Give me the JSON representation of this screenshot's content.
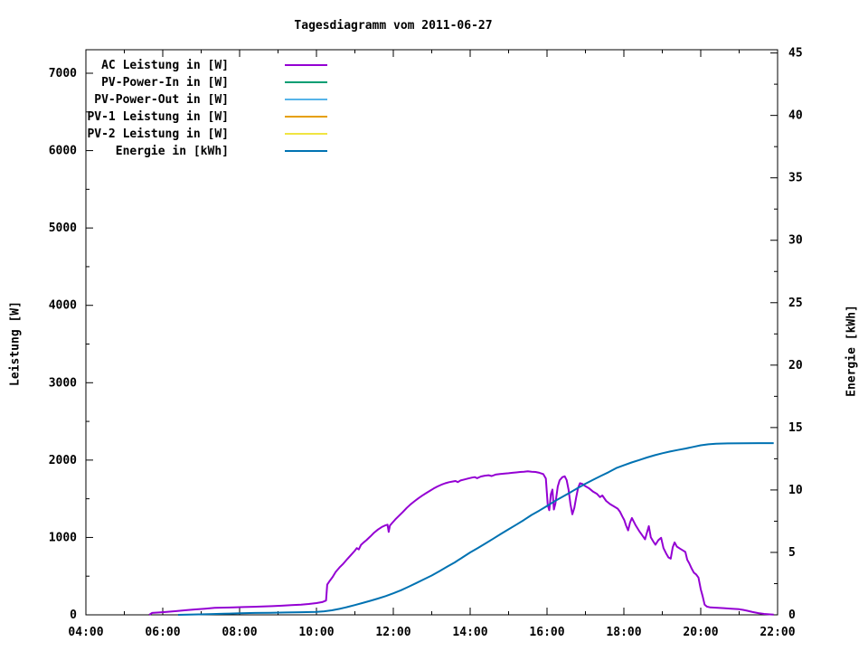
{
  "title": "Tagesdiagramm vom 2011-06-27",
  "axes": {
    "x": {
      "min_hour": 4,
      "max_hour": 22,
      "major_step_hours": 2,
      "minor_step_hours": 1,
      "tick_labels": [
        "04:00",
        "06:00",
        "08:00",
        "10:00",
        "12:00",
        "14:00",
        "16:00",
        "18:00",
        "20:00",
        "22:00"
      ]
    },
    "y_left": {
      "label": "Leistung [W]",
      "min": 0,
      "max": 7000,
      "major_step": 1000,
      "minor_step": 500,
      "tick_labels": [
        "0",
        "1000",
        "2000",
        "3000",
        "4000",
        "5000",
        "6000",
        "7000"
      ]
    },
    "y_right": {
      "label": "Energie [kWh]",
      "min": 0,
      "max": 45,
      "major_step": 5,
      "minor_step": 2.5,
      "tick_labels": [
        "0",
        "5",
        "10",
        "15",
        "20",
        "25",
        "30",
        "35",
        "40",
        "45"
      ]
    }
  },
  "legend": {
    "position": "inside-top-left",
    "items": [
      {
        "label": "AC Leistung in [W]",
        "color": "#9400d3"
      },
      {
        "label": "PV-Power-In in [W]",
        "color": "#009e73"
      },
      {
        "label": "PV-Power-Out in [W]",
        "color": "#56b4e9"
      },
      {
        "label": "PV-1 Leistung in [W]",
        "color": "#e69f00"
      },
      {
        "label": "PV-2 Leistung in [W]",
        "color": "#f0e442"
      },
      {
        "label": "Energie in [kWh]",
        "color": "#0072b2"
      }
    ]
  },
  "chart_data": {
    "type": "line",
    "title": "Tagesdiagramm vom 2011-06-27",
    "xlabel": "",
    "ylabel": "Leistung [W]",
    "y2label": "Energie [kWh]",
    "x_range_hours": [
      4,
      22
    ],
    "y_left_range": [
      0,
      7000
    ],
    "y_right_range": [
      0,
      45
    ],
    "grid": false,
    "legend_position": "inside-top-left",
    "series": [
      {
        "name": "AC Leistung in [W]",
        "color": "#9400d3",
        "axis": "left",
        "unit": "W",
        "points": [
          [
            5.65,
            0
          ],
          [
            5.72,
            25
          ],
          [
            5.9,
            30
          ],
          [
            6.1,
            38
          ],
          [
            6.35,
            48
          ],
          [
            6.6,
            60
          ],
          [
            6.85,
            70
          ],
          [
            7.1,
            80
          ],
          [
            7.35,
            90
          ],
          [
            7.6,
            93
          ],
          [
            7.85,
            96
          ],
          [
            8.1,
            100
          ],
          [
            8.35,
            104
          ],
          [
            8.6,
            108
          ],
          [
            8.85,
            112
          ],
          [
            9.1,
            118
          ],
          [
            9.35,
            125
          ],
          [
            9.6,
            132
          ],
          [
            9.8,
            140
          ],
          [
            10.0,
            152
          ],
          [
            10.15,
            165
          ],
          [
            10.25,
            185
          ],
          [
            10.28,
            390
          ],
          [
            10.34,
            435
          ],
          [
            10.42,
            490
          ],
          [
            10.5,
            555
          ],
          [
            10.6,
            612
          ],
          [
            10.7,
            662
          ],
          [
            10.8,
            720
          ],
          [
            10.9,
            775
          ],
          [
            11.0,
            830
          ],
          [
            11.05,
            862
          ],
          [
            11.1,
            845
          ],
          [
            11.16,
            905
          ],
          [
            11.22,
            932
          ],
          [
            11.3,
            965
          ],
          [
            11.4,
            1012
          ],
          [
            11.5,
            1062
          ],
          [
            11.6,
            1102
          ],
          [
            11.7,
            1135
          ],
          [
            11.8,
            1158
          ],
          [
            11.85,
            1165
          ],
          [
            11.88,
            1072
          ],
          [
            11.91,
            1152
          ],
          [
            11.96,
            1182
          ],
          [
            12.05,
            1232
          ],
          [
            12.15,
            1282
          ],
          [
            12.25,
            1330
          ],
          [
            12.35,
            1382
          ],
          [
            12.45,
            1428
          ],
          [
            12.55,
            1468
          ],
          [
            12.65,
            1505
          ],
          [
            12.75,
            1540
          ],
          [
            12.85,
            1572
          ],
          [
            12.95,
            1602
          ],
          [
            13.05,
            1632
          ],
          [
            13.15,
            1660
          ],
          [
            13.25,
            1682
          ],
          [
            13.35,
            1700
          ],
          [
            13.45,
            1714
          ],
          [
            13.55,
            1724
          ],
          [
            13.62,
            1730
          ],
          [
            13.68,
            1716
          ],
          [
            13.75,
            1736
          ],
          [
            13.85,
            1750
          ],
          [
            13.95,
            1762
          ],
          [
            14.05,
            1774
          ],
          [
            14.12,
            1780
          ],
          [
            14.18,
            1766
          ],
          [
            14.28,
            1788
          ],
          [
            14.38,
            1798
          ],
          [
            14.48,
            1804
          ],
          [
            14.56,
            1794
          ],
          [
            14.66,
            1812
          ],
          [
            14.78,
            1820
          ],
          [
            14.9,
            1826
          ],
          [
            15.0,
            1830
          ],
          [
            15.1,
            1836
          ],
          [
            15.2,
            1840
          ],
          [
            15.3,
            1846
          ],
          [
            15.4,
            1850
          ],
          [
            15.5,
            1856
          ],
          [
            15.6,
            1850
          ],
          [
            15.7,
            1846
          ],
          [
            15.8,
            1836
          ],
          [
            15.9,
            1820
          ],
          [
            15.97,
            1762
          ],
          [
            16.02,
            1420
          ],
          [
            16.06,
            1352
          ],
          [
            16.1,
            1560
          ],
          [
            16.14,
            1620
          ],
          [
            16.18,
            1362
          ],
          [
            16.22,
            1440
          ],
          [
            16.28,
            1660
          ],
          [
            16.33,
            1740
          ],
          [
            16.4,
            1780
          ],
          [
            16.46,
            1790
          ],
          [
            16.51,
            1742
          ],
          [
            16.56,
            1620
          ],
          [
            16.61,
            1432
          ],
          [
            16.66,
            1300
          ],
          [
            16.71,
            1382
          ],
          [
            16.76,
            1522
          ],
          [
            16.81,
            1642
          ],
          [
            16.86,
            1702
          ],
          [
            16.92,
            1692
          ],
          [
            17.0,
            1662
          ],
          [
            17.1,
            1632
          ],
          [
            17.2,
            1592
          ],
          [
            17.3,
            1562
          ],
          [
            17.38,
            1522
          ],
          [
            17.44,
            1542
          ],
          [
            17.54,
            1472
          ],
          [
            17.64,
            1432
          ],
          [
            17.74,
            1402
          ],
          [
            17.84,
            1372
          ],
          [
            17.9,
            1332
          ],
          [
            17.96,
            1272
          ],
          [
            18.01,
            1226
          ],
          [
            18.06,
            1152
          ],
          [
            18.11,
            1092
          ],
          [
            18.16,
            1192
          ],
          [
            18.21,
            1252
          ],
          [
            18.3,
            1162
          ],
          [
            18.4,
            1082
          ],
          [
            18.5,
            1012
          ],
          [
            18.55,
            976
          ],
          [
            18.6,
            1062
          ],
          [
            18.65,
            1146
          ],
          [
            18.7,
            1002
          ],
          [
            18.76,
            952
          ],
          [
            18.82,
            906
          ],
          [
            18.9,
            966
          ],
          [
            18.97,
            996
          ],
          [
            19.03,
            862
          ],
          [
            19.1,
            792
          ],
          [
            19.16,
            742
          ],
          [
            19.22,
            726
          ],
          [
            19.27,
            872
          ],
          [
            19.32,
            936
          ],
          [
            19.38,
            882
          ],
          [
            19.46,
            856
          ],
          [
            19.54,
            832
          ],
          [
            19.6,
            812
          ],
          [
            19.65,
            712
          ],
          [
            19.7,
            666
          ],
          [
            19.76,
            602
          ],
          [
            19.82,
            546
          ],
          [
            19.88,
            522
          ],
          [
            19.94,
            482
          ],
          [
            20.0,
            332
          ],
          [
            20.05,
            242
          ],
          [
            20.1,
            132
          ],
          [
            20.16,
            106
          ],
          [
            20.25,
            96
          ],
          [
            20.4,
            92
          ],
          [
            20.6,
            86
          ],
          [
            20.8,
            80
          ],
          [
            21.0,
            72
          ],
          [
            21.1,
            64
          ],
          [
            21.2,
            54
          ],
          [
            21.35,
            36
          ],
          [
            21.5,
            22
          ],
          [
            21.65,
            12
          ],
          [
            21.8,
            6
          ],
          [
            21.9,
            2
          ]
        ]
      },
      {
        "name": "PV-Power-In in [W]",
        "color": "#009e73",
        "axis": "left",
        "unit": "W",
        "points": []
      },
      {
        "name": "PV-Power-Out in [W]",
        "color": "#56b4e9",
        "axis": "left",
        "unit": "W",
        "points": []
      },
      {
        "name": "PV-1 Leistung in [W]",
        "color": "#e69f00",
        "axis": "left",
        "unit": "W",
        "points": []
      },
      {
        "name": "PV-2 Leistung in [W]",
        "color": "#f0e442",
        "axis": "left",
        "unit": "W",
        "points": []
      },
      {
        "name": "Energie in [kWh]",
        "color": "#0072b2",
        "axis": "right",
        "unit": "kWh",
        "points": [
          [
            6.4,
            0.0
          ],
          [
            6.8,
            0.03
          ],
          [
            7.2,
            0.06
          ],
          [
            7.6,
            0.09
          ],
          [
            8.0,
            0.12
          ],
          [
            8.4,
            0.15
          ],
          [
            8.8,
            0.17
          ],
          [
            9.2,
            0.19
          ],
          [
            9.6,
            0.21
          ],
          [
            10.0,
            0.24
          ],
          [
            10.2,
            0.28
          ],
          [
            10.4,
            0.36
          ],
          [
            10.6,
            0.48
          ],
          [
            10.8,
            0.62
          ],
          [
            11.0,
            0.78
          ],
          [
            11.2,
            0.95
          ],
          [
            11.4,
            1.12
          ],
          [
            11.6,
            1.3
          ],
          [
            11.8,
            1.5
          ],
          [
            12.0,
            1.72
          ],
          [
            12.2,
            1.97
          ],
          [
            12.4,
            2.25
          ],
          [
            12.6,
            2.55
          ],
          [
            12.8,
            2.85
          ],
          [
            13.0,
            3.15
          ],
          [
            13.2,
            3.5
          ],
          [
            13.4,
            3.85
          ],
          [
            13.6,
            4.2
          ],
          [
            13.8,
            4.6
          ],
          [
            14.0,
            5.0
          ],
          [
            14.2,
            5.35
          ],
          [
            14.4,
            5.72
          ],
          [
            14.6,
            6.1
          ],
          [
            14.8,
            6.48
          ],
          [
            15.0,
            6.85
          ],
          [
            15.2,
            7.22
          ],
          [
            15.4,
            7.6
          ],
          [
            15.6,
            8.0
          ],
          [
            15.8,
            8.35
          ],
          [
            16.0,
            8.72
          ],
          [
            16.2,
            9.1
          ],
          [
            16.4,
            9.45
          ],
          [
            16.6,
            9.8
          ],
          [
            16.8,
            10.15
          ],
          [
            17.0,
            10.5
          ],
          [
            17.2,
            10.82
          ],
          [
            17.4,
            11.12
          ],
          [
            17.6,
            11.42
          ],
          [
            17.8,
            11.75
          ],
          [
            18.0,
            11.98
          ],
          [
            18.2,
            12.2
          ],
          [
            18.4,
            12.4
          ],
          [
            18.6,
            12.6
          ],
          [
            18.8,
            12.78
          ],
          [
            19.0,
            12.94
          ],
          [
            19.2,
            13.08
          ],
          [
            19.4,
            13.2
          ],
          [
            19.6,
            13.32
          ],
          [
            19.8,
            13.45
          ],
          [
            20.0,
            13.58
          ],
          [
            20.2,
            13.66
          ],
          [
            20.4,
            13.71
          ],
          [
            20.7,
            13.73
          ],
          [
            21.1,
            13.74
          ],
          [
            21.5,
            13.75
          ],
          [
            21.9,
            13.75
          ]
        ]
      }
    ]
  }
}
